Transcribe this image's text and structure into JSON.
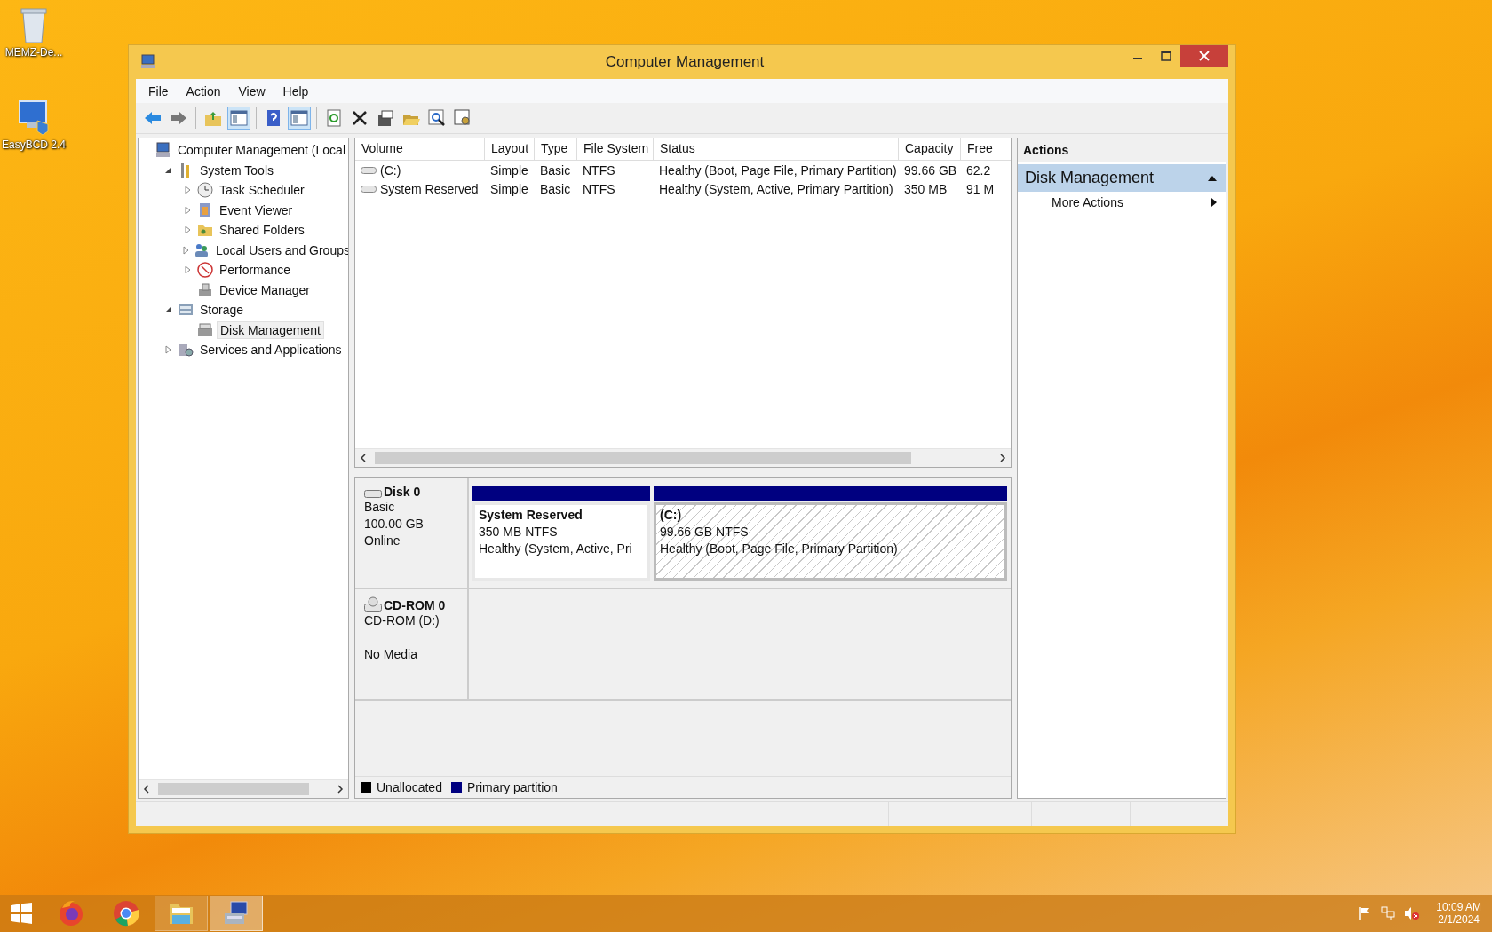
{
  "desktop_icons": [
    {
      "label": "MEMZ-De..."
    },
    {
      "label": "EasyBCD 2.4"
    }
  ],
  "window": {
    "title": "Computer Management"
  },
  "menu": [
    "File",
    "Action",
    "View",
    "Help"
  ],
  "toolbar": [
    {
      "pressed": false
    },
    {
      "pressed": false
    },
    {
      "pressed": false
    },
    {
      "pressed": true
    },
    {
      "pressed": false
    },
    {
      "pressed": true
    },
    {
      "pressed": false
    },
    {
      "pressed": false
    },
    {
      "pressed": false
    },
    {
      "pressed": false
    },
    {
      "pressed": false
    },
    {
      "pressed": false
    }
  ],
  "tree": [
    {
      "label": "Computer Management (Local",
      "selected": false,
      "children": [
        {
          "label": "System Tools",
          "selected": false,
          "expanded": true,
          "children": [
            {
              "label": "Task Scheduler",
              "selected": false,
              "expanded": false
            },
            {
              "label": "Event Viewer",
              "selected": false,
              "expanded": false
            },
            {
              "label": "Shared Folders",
              "selected": false,
              "expanded": false
            },
            {
              "label": "Local Users and Groups",
              "selected": false,
              "expanded": false
            },
            {
              "label": "Performance",
              "selected": false,
              "expanded": false
            },
            {
              "label": "Device Manager",
              "selected": false
            }
          ]
        },
        {
          "label": "Storage",
          "selected": false,
          "expanded": true,
          "children": [
            {
              "label": "Disk Management",
              "selected": true
            }
          ]
        },
        {
          "label": "Services and Applications",
          "selected": false,
          "expanded": false
        }
      ]
    }
  ],
  "table": {
    "columns": [
      "Volume",
      "Layout",
      "Type",
      "File System",
      "Status",
      "Capacity",
      "Free"
    ],
    "rows": [
      {
        "selected": false,
        "cells": [
          "(C:)",
          "Simple",
          "Basic",
          "NTFS",
          "Healthy (Boot, Page File, Primary Partition)",
          "99.66 GB",
          "62.2"
        ]
      },
      {
        "selected": false,
        "cells": [
          "System Reserved",
          "Simple",
          "Basic",
          "NTFS",
          "Healthy (System, Active, Primary Partition)",
          "350 MB",
          "91 M"
        ]
      }
    ]
  },
  "disks": [
    {
      "kind": "disk",
      "name": "Disk 0",
      "lines": [
        "Basic",
        "100.00 GB",
        "Online"
      ],
      "partitions": [
        {
          "name": "System Reserved",
          "size": "350 MB NTFS",
          "status": "Healthy (System, Active, Pri",
          "selected": false
        },
        {
          "name": "(C:)",
          "size": "99.66 GB NTFS",
          "status": "Healthy (Boot, Page File, Primary Partition)",
          "selected": true
        }
      ]
    },
    {
      "kind": "cdrom",
      "name": "CD-ROM 0",
      "lines": [
        "CD-ROM (D:)",
        "No Media"
      ]
    }
  ],
  "legend": [
    {
      "label": "Unallocated",
      "color": "#000000"
    },
    {
      "label": "Primary partition",
      "color": "#000080"
    }
  ],
  "actions": {
    "header": "Actions",
    "section": {
      "title": "Disk Management",
      "expanded": true
    },
    "items": [
      {
        "label": "More Actions"
      }
    ]
  },
  "taskbar": {
    "apps": [
      {
        "running": false,
        "active": false
      },
      {
        "running": false,
        "active": false
      },
      {
        "running": true,
        "active": false
      },
      {
        "running": true,
        "active": true
      }
    ],
    "time": "10:09 AM",
    "date": "2/1/2024"
  }
}
